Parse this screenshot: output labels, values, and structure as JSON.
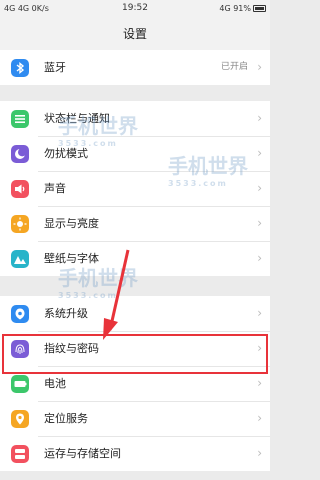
{
  "status_bar": {
    "left": "4G 4G 0K/s",
    "time": "19:52",
    "right": "4G 91%"
  },
  "page_title": "设置",
  "groups": [
    [
      {
        "label": "蓝牙",
        "value": "已开启",
        "icon": "bluetooth-icon",
        "color": "#2f8bf0"
      }
    ],
    [
      {
        "label": "状态栏与通知",
        "value": "",
        "icon": "notification-icon",
        "color": "#3cc76b"
      },
      {
        "label": "勿扰模式",
        "value": "",
        "icon": "moon-icon",
        "color": "#7b5cd6"
      },
      {
        "label": "声音",
        "value": "",
        "icon": "speaker-icon",
        "color": "#f2515f"
      },
      {
        "label": "显示与亮度",
        "value": "",
        "icon": "brightness-icon",
        "color": "#f5a623"
      },
      {
        "label": "壁纸与字体",
        "value": "",
        "icon": "wallpaper-icon",
        "color": "#28b4c9"
      }
    ],
    [
      {
        "label": "系统升级",
        "value": "",
        "icon": "upgrade-icon",
        "color": "#2f8bf0"
      },
      {
        "label": "指纹与密码",
        "value": "",
        "icon": "fingerprint-icon",
        "color": "#7b5cd6"
      },
      {
        "label": "电池",
        "value": "",
        "icon": "battery-icon",
        "color": "#3cc76b"
      },
      {
        "label": "定位服务",
        "value": "",
        "icon": "location-icon",
        "color": "#f5a623"
      },
      {
        "label": "运存与存储空间",
        "value": "",
        "icon": "storage-icon",
        "color": "#f2515f"
      }
    ]
  ],
  "watermark": {
    "text": "手机世界",
    "subtext": "3533.com"
  }
}
